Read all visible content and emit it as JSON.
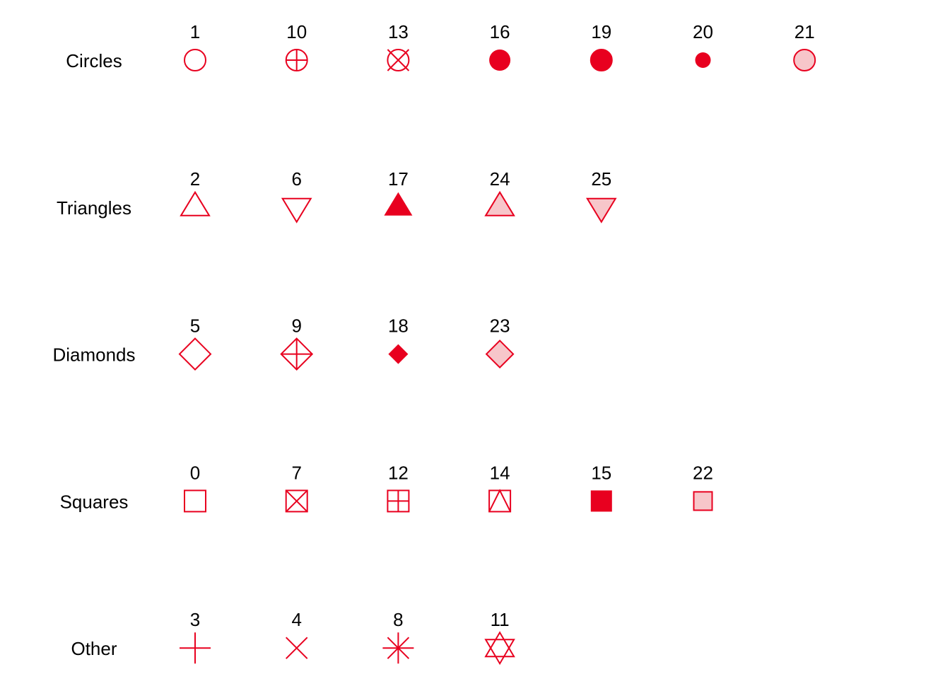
{
  "chart_data": {
    "type": "scatter",
    "title": "",
    "description": "R plotting symbols (pch) grouped by shape family",
    "colors": {
      "stroke": "#e8001f",
      "fill": "#f7c6ca",
      "text": "#000000"
    },
    "rows": [
      {
        "label": "Circles",
        "pch": [
          "1",
          "10",
          "13",
          "16",
          "19",
          "20",
          "21"
        ]
      },
      {
        "label": "Triangles",
        "pch": [
          "2",
          "6",
          "17",
          "24",
          "25"
        ]
      },
      {
        "label": "Diamonds",
        "pch": [
          "5",
          "9",
          "18",
          "23"
        ]
      },
      {
        "label": "Squares",
        "pch": [
          "0",
          "7",
          "12",
          "14",
          "15",
          "22"
        ]
      },
      {
        "label": "Other",
        "pch": [
          "3",
          "4",
          "8",
          "11"
        ]
      }
    ]
  }
}
